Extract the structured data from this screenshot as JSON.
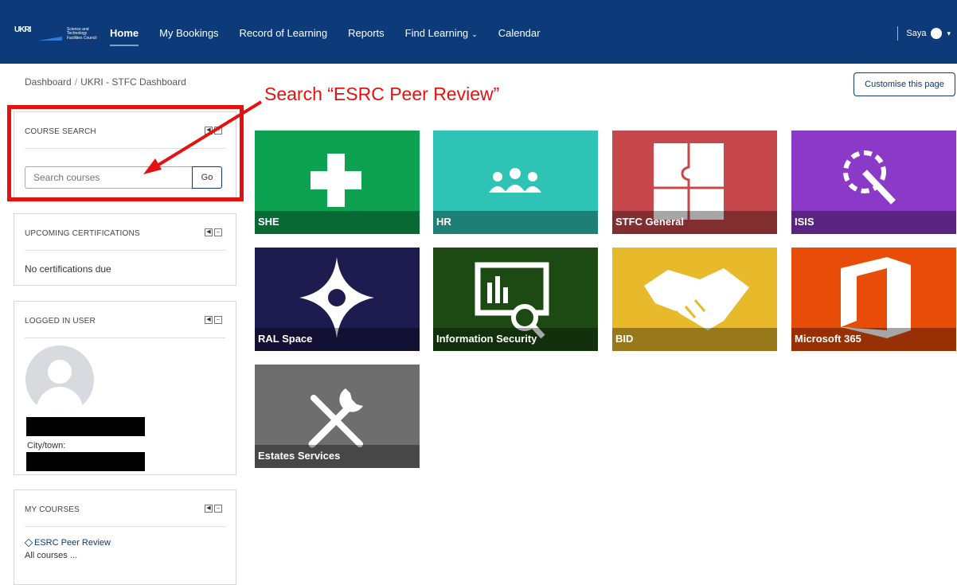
{
  "logo": {
    "mark": "UKRI",
    "text_line1": "Science and",
    "text_line2": "Technology",
    "text_line3": "Facilities Council"
  },
  "nav": {
    "items": [
      "Home",
      "My Bookings",
      "Record of Learning",
      "Reports",
      "Find Learning",
      "Calendar"
    ],
    "active": "Home"
  },
  "user": {
    "name": "Saya"
  },
  "breadcrumb": {
    "items": [
      "Dashboard",
      "UKRI - STFC Dashboard"
    ],
    "separator": "/"
  },
  "customise_label": "Customise this page",
  "annotation": {
    "text": "Search “ESRC Peer Review”",
    "color": "#e41111"
  },
  "blocks": {
    "course_search": {
      "title": "COURSE SEARCH",
      "placeholder": "Search courses",
      "go_label": "Go"
    },
    "upcoming": {
      "title": "UPCOMING CERTIFICATIONS",
      "message": "No certifications due"
    },
    "logged_in": {
      "title": "LOGGED IN USER",
      "city_label": "City/town:"
    },
    "my_courses": {
      "title": "MY COURSES",
      "course": "ESRC Peer Review",
      "all_courses": "All courses ..."
    }
  },
  "tiles": [
    {
      "label": "SHE",
      "color": "#0da152",
      "icon": "plus-icon"
    },
    {
      "label": "HR",
      "color": "#2fc3b5",
      "icon": "people-icon"
    },
    {
      "label": "STFC General",
      "color": "#c7484a",
      "icon": "puzzle-icon"
    },
    {
      "label": "ISIS",
      "color": "#8a3ac7",
      "icon": "magic-wand-icon"
    },
    {
      "label": "RAL Space",
      "color": "#1d1b4f",
      "icon": "star-compass-icon"
    },
    {
      "label": "Information Security",
      "color": "#1d4a12",
      "icon": "analytics-search-icon"
    },
    {
      "label": "BID",
      "color": "#e8b92a",
      "icon": "handshake-icon"
    },
    {
      "label": "Microsoft 365",
      "color": "#e84c09",
      "icon": "office-icon"
    },
    {
      "label": "Estates Services",
      "color": "#6e6e6e",
      "icon": "tools-icon"
    }
  ],
  "colors": {
    "topbar": "#0d3a78",
    "accent": "#0d3a78",
    "highlight": "#e41111"
  }
}
